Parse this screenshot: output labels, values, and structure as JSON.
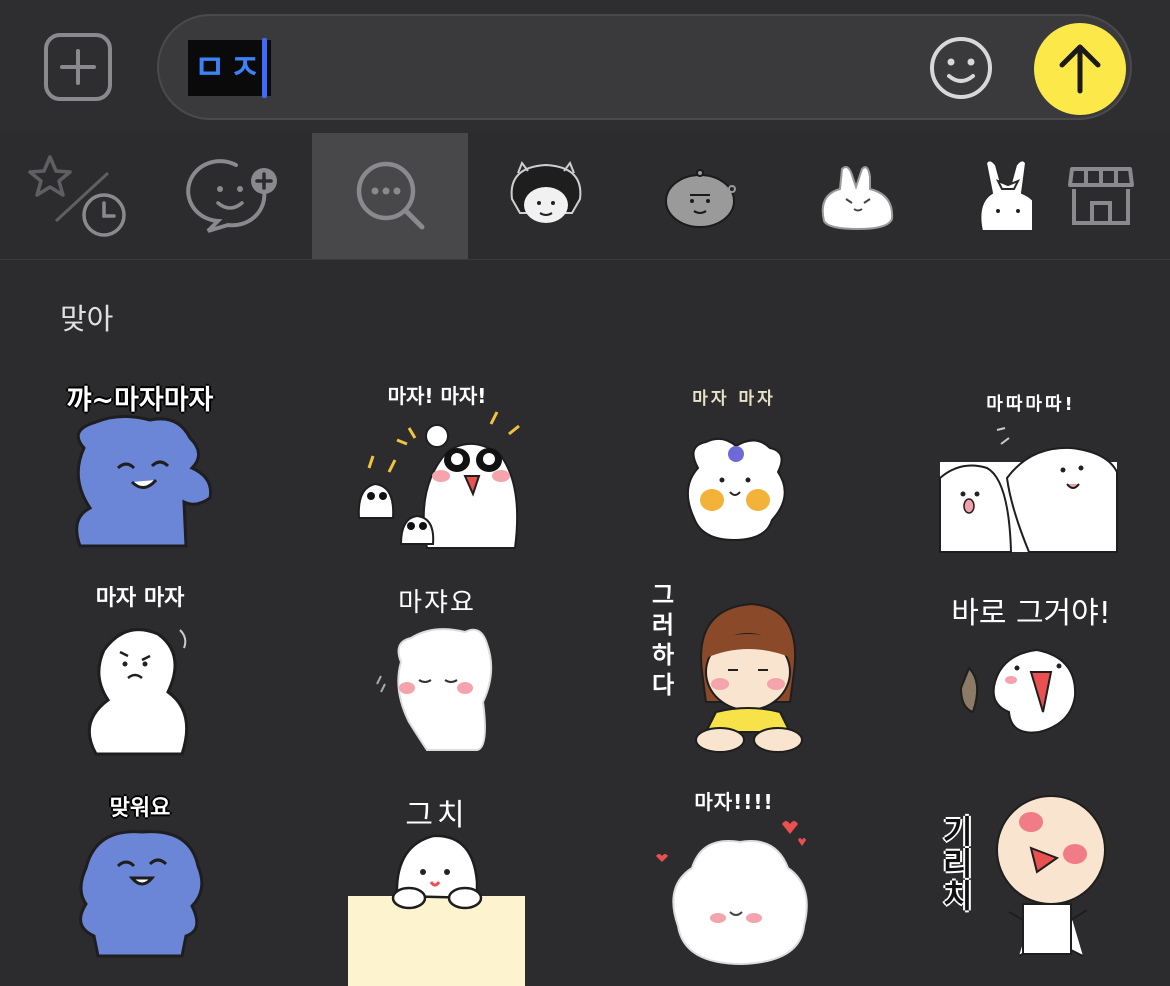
{
  "input": {
    "text": "ㅁㅈ"
  },
  "section_title": "맞아",
  "tabs": [
    {
      "icon": "favorites-recent-icon"
    },
    {
      "icon": "chat-add-icon"
    },
    {
      "icon": "search-icon"
    },
    {
      "icon": "girl-sticker-icon"
    },
    {
      "icon": "round-character-icon"
    },
    {
      "icon": "bunny-blob-icon"
    },
    {
      "icon": "bow-bunny-icon"
    },
    {
      "icon": "store-icon"
    }
  ],
  "stickers": [
    {
      "caption": "꺄~마자마자"
    },
    {
      "caption": "마자! 마자!"
    },
    {
      "caption": "마자 마자"
    },
    {
      "caption": "마따마따!"
    },
    {
      "caption": "마자 마자"
    },
    {
      "caption": "마쟈요"
    },
    {
      "caption": "그러하다"
    },
    {
      "caption": "바로 그거야!"
    },
    {
      "caption": "맞워요"
    },
    {
      "caption": "그치"
    },
    {
      "caption": "마자!!!!"
    },
    {
      "caption": "기리치"
    }
  ],
  "colors": {
    "send": "#fde84a",
    "caret": "#3b6bff",
    "sticker_blue": "#6b86d6"
  }
}
